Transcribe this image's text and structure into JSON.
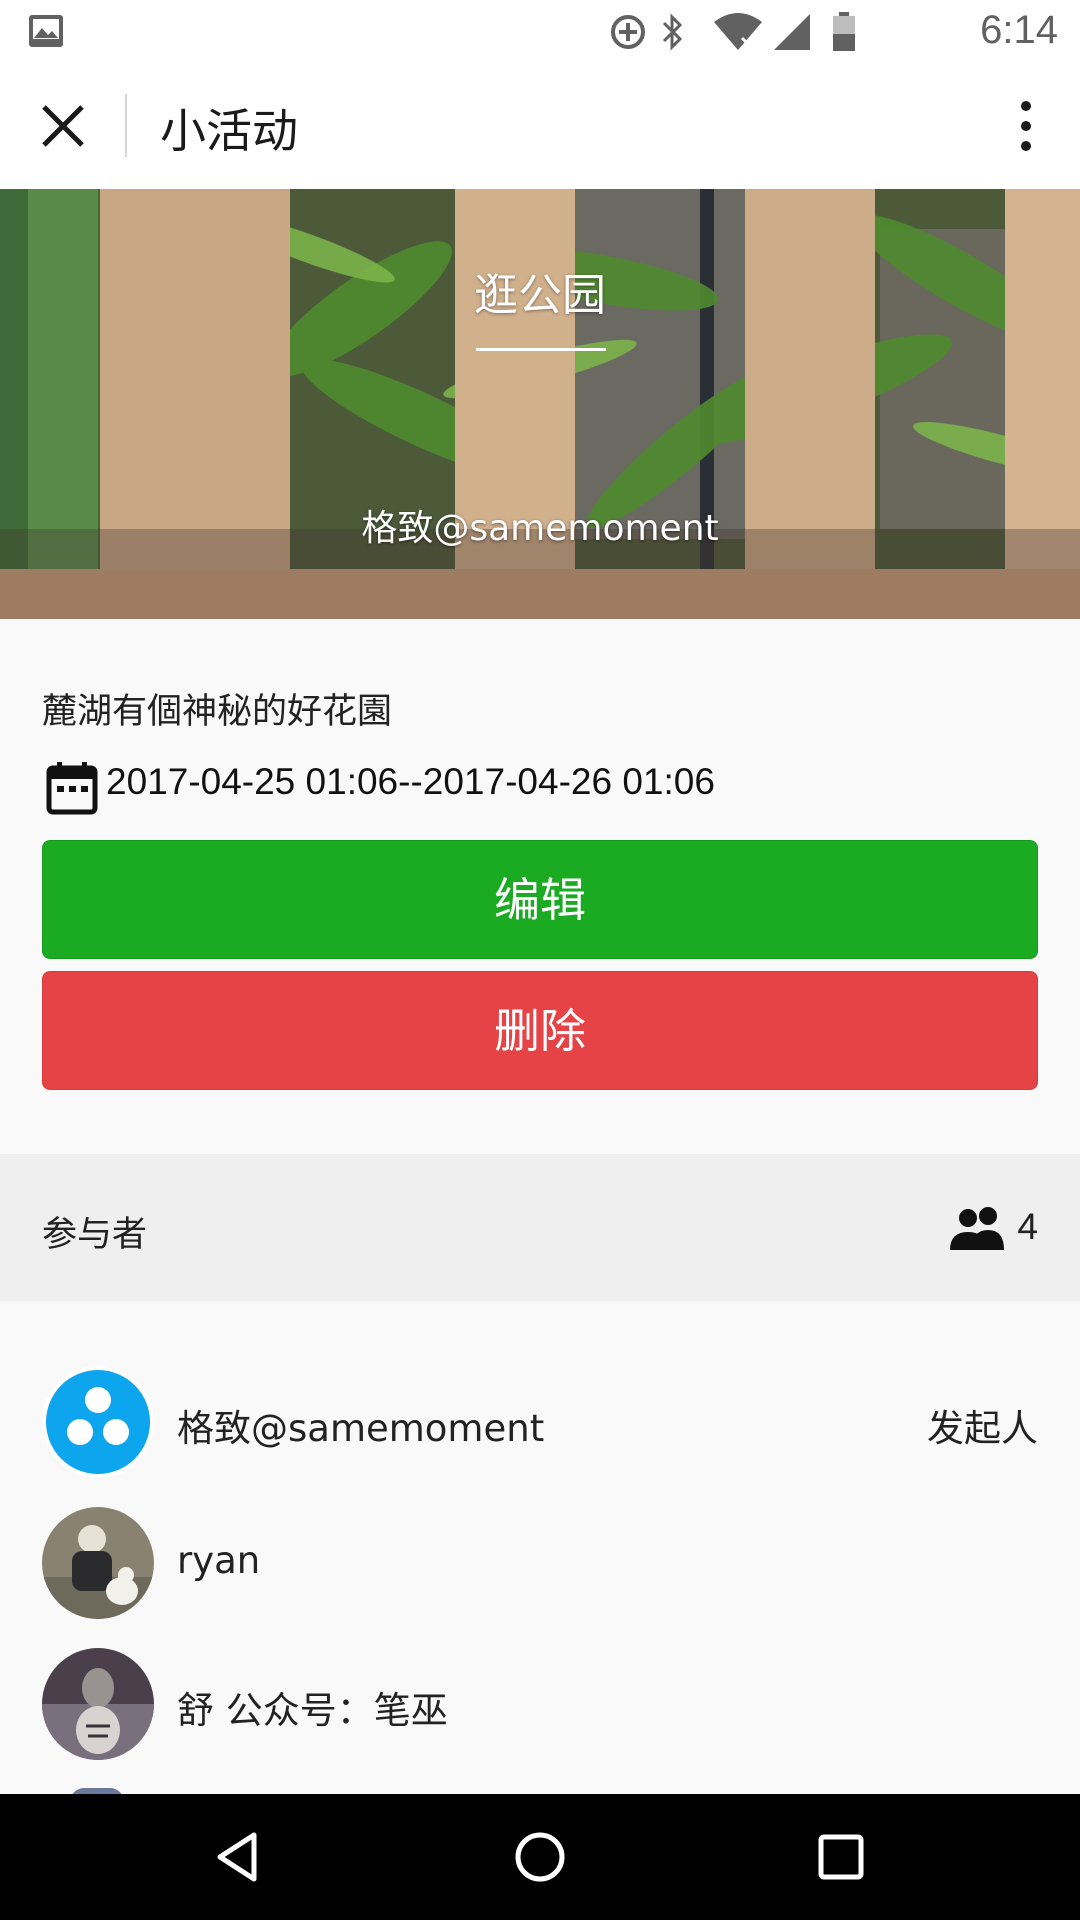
{
  "status_bar": {
    "time": "6:14",
    "icons": [
      "gallery-icon",
      "data-saver-icon",
      "bluetooth-icon",
      "wifi-icon",
      "signal-icon",
      "battery-icon"
    ]
  },
  "title_bar": {
    "title": "小活动",
    "close_icon": "close-icon",
    "more_icon": "more-vert-icon"
  },
  "hero": {
    "title": "逛公园",
    "author": "格致@samemoment"
  },
  "activity": {
    "description": "麓湖有個神秘的好花園",
    "date_range": "2017-04-25 01:06--2017-04-26 01:06",
    "edit_label": "编辑",
    "delete_label": "删除"
  },
  "participants": {
    "header": "参与者",
    "count": "4",
    "items": [
      {
        "name": "格致@samemoment",
        "role": "发起人"
      },
      {
        "name": "ryan",
        "role": ""
      },
      {
        "name": "舒 公众号：笔巫",
        "role": ""
      }
    ]
  },
  "colors": {
    "edit_button": "#1aab23",
    "delete_button": "#e54345",
    "avatar_blue": "#0ea5ef"
  }
}
